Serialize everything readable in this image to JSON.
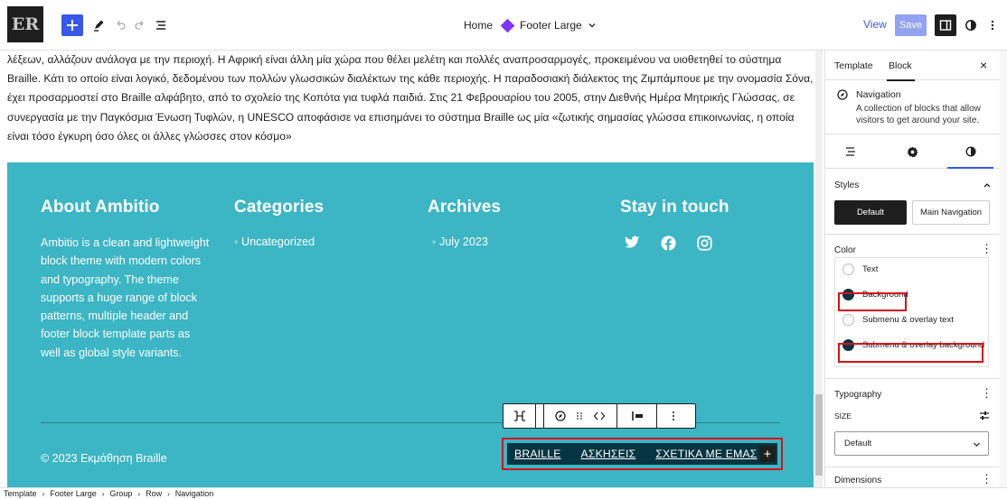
{
  "header": {
    "logo_text": "ER",
    "breadcrumb_home": "Home",
    "template_name": "Footer Large",
    "view_label": "View",
    "save_label": "Save"
  },
  "canvas": {
    "body_text": "λέξεων, αλλάζουν ανάλογα με την περιοχή. Η Αφρική είναι άλλη μία χώρα που θέλει μελέτη και πολλές αναπροσαρμογές, προκειμένου να υιοθετηθεί το σύστημα Braille. Κάτι το οποίο είναι λογικό, δεδομένου των πολλών γλωσσικών διαλέκτων της κάθε περιοχής. Η παραδοσιακή διάλεκτος της Ζιμπάμπουε με την ονομασία Σόνα, έχει προσαρμοστεί στο Braille αλφάβητο, από το σχολείο της Κοπότα για τυφλά παιδιά. Στις 21 Φεβρουαρίου του 2005, στην Διεθνής Ημέρα Μητρικής Γλώσσας, σε συνεργασία με την Παγκόσμια Ένωση Τυφλών, η UNESCO αποφάσισε να επισημάνει το σύστημα Braille ως μία «ζωτικής σημασίας γλώσσα επικοινωνίας, η οποία είναι τόσο έγκυρη όσο όλες οι άλλες γλώσσες στον κόσμο»",
    "footer": {
      "about_title": "About Ambitio",
      "about_text": "Ambitio is a clean and lightweight block theme with modern colors and typography. The theme supports a huge range of block patterns, multiple header and footer block template parts as well as global style variants.",
      "categories_title": "Categories",
      "categories_item": "Uncategorized",
      "archives_title": "Archives",
      "archives_item": "July 2023",
      "social_title": "Stay in touch",
      "social_icons": [
        "twitter-icon",
        "facebook-icon",
        "instagram-icon"
      ],
      "copyright": "© 2023 Εκμάθηση Braille",
      "nav_links": [
        "BRAILLE",
        "ΑΣΚΗΣΕΙΣ",
        "ΣΧΕΤΙΚΑ ΜΕ ΕΜΑΣ"
      ],
      "nav_add": "+",
      "background_color": "#3cb5c5",
      "nav_background_color": "#073543"
    }
  },
  "sidebar": {
    "tab_template": "Template",
    "tab_block": "Block",
    "close": "×",
    "block_title": "Navigation",
    "block_desc": "A collection of blocks that allow visitors to get around your site.",
    "styles_label": "Styles",
    "style_default": "Default",
    "style_main_nav": "Main Navigation",
    "color_label": "Color",
    "color_items": [
      "Text",
      "Background",
      "Submenu & overlay text",
      "Submenu & overlay background"
    ],
    "typography_label": "Typography",
    "size_label": "SIZE",
    "size_value": "Default",
    "dimensions_label": "Dimensions"
  },
  "breadcrumbs": [
    "Template",
    "Footer Large",
    "Group",
    "Row",
    "Navigation"
  ],
  "colors": {
    "accent": "#3858e9",
    "highlight": "#d4111a"
  }
}
